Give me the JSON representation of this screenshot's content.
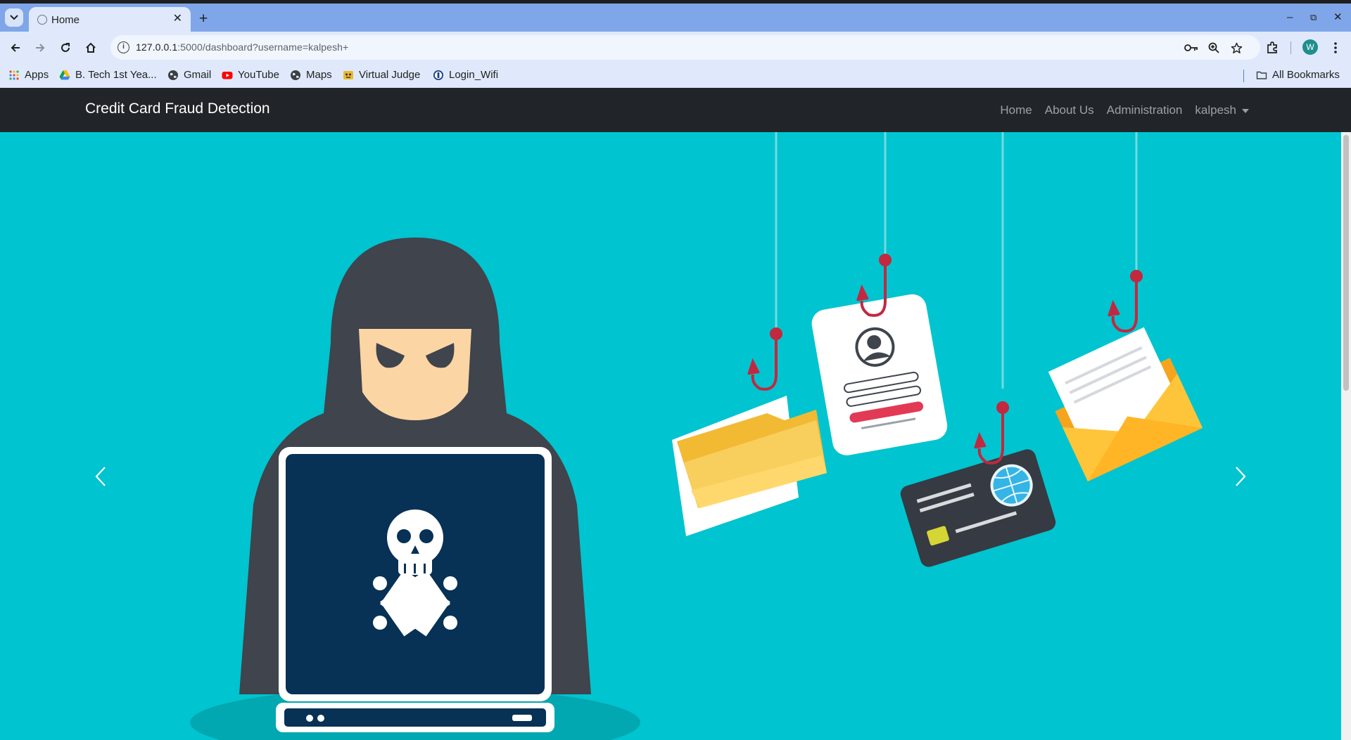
{
  "browser": {
    "tab": {
      "title": "Home"
    },
    "new_tab_symbol": "+",
    "window_controls": {
      "minimize": "–",
      "restore": "⧉",
      "close": "✕"
    },
    "url": {
      "host": "127.0.0.1",
      "rest": ":5000/dashboard?username=kalpesh+"
    },
    "bookmarks": [
      {
        "label": "Apps",
        "icon": "apps-grid-icon"
      },
      {
        "label": "B. Tech 1st Yea...",
        "icon": "google-drive-icon"
      },
      {
        "label": "Gmail",
        "icon": "globe-icon"
      },
      {
        "label": "YouTube",
        "icon": "youtube-icon"
      },
      {
        "label": "Maps",
        "icon": "globe-icon"
      },
      {
        "label": "Virtual Judge",
        "icon": "virtual-judge-icon"
      },
      {
        "label": "Login_Wifi",
        "icon": "login-wifi-icon"
      }
    ],
    "all_bookmarks": "All Bookmarks",
    "profile_initial": "W"
  },
  "site": {
    "brand": "Credit Card Fraud Detection",
    "nav": {
      "home": "Home",
      "about": "About Us",
      "administration": "Administration",
      "user": "kalpesh"
    }
  },
  "colors": {
    "tabstrip": "#7fa6e8",
    "toolbar": "#dfe9fb",
    "navbar": "#212529",
    "hero_background": "#00c4cf",
    "hoodie": "#3f444d",
    "laptop_screen": "#073155",
    "folder": "#f8c84a",
    "envelope": "#ffbc2c",
    "card": "#363a42",
    "hook": "#c2283f"
  }
}
